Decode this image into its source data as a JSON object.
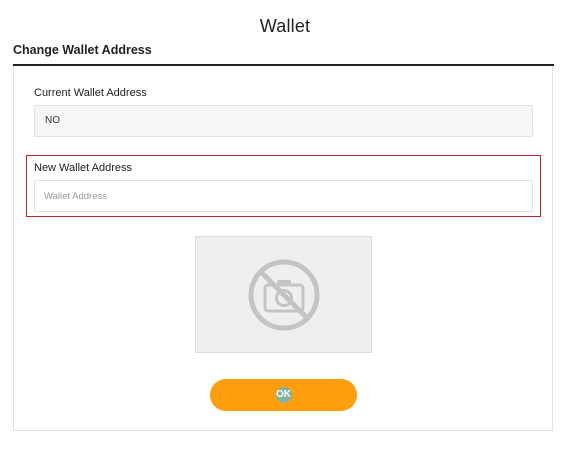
{
  "header": {
    "title": "Wallet",
    "section_title": "Change Wallet Address"
  },
  "current_wallet": {
    "label": "Current Wallet Address",
    "value": "NO"
  },
  "new_wallet": {
    "label": "New Wallet Address",
    "placeholder": "Wallet Address",
    "value": ""
  },
  "image_placeholder": {
    "icon": "no-camera-icon"
  },
  "actions": {
    "ok_label": "OK"
  },
  "colors": {
    "accent": "#ff9f0e",
    "highlight_border": "#c0242b",
    "ok_badge": "#7fb2a4"
  }
}
